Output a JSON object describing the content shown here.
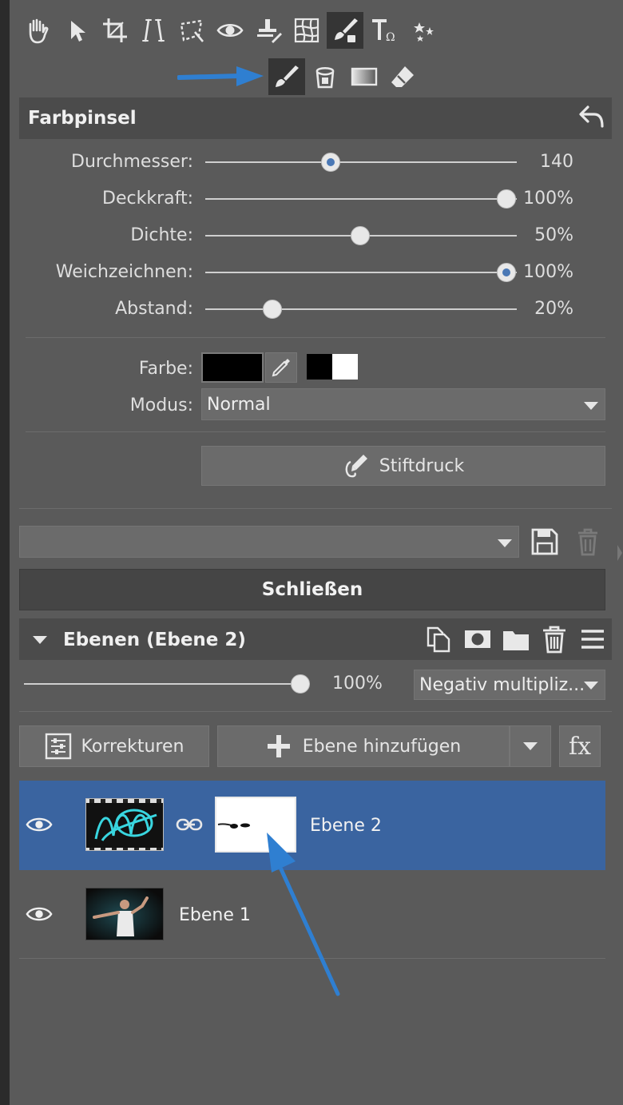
{
  "toolbar": {
    "tools": [
      "hand-icon",
      "pointer-icon",
      "crop-icon",
      "straighten-icon",
      "perspective-icon",
      "eye-icon",
      "stamp-icon",
      "grid-icon",
      "brush-icon",
      "text-icon",
      "effects-icon"
    ],
    "active_tool": "brush-icon",
    "subtools": [
      "paint-brush-icon",
      "bucket-icon",
      "gradient-icon",
      "eraser-icon"
    ],
    "active_subtool": "paint-brush-icon"
  },
  "brush_panel": {
    "title": "Farbpinsel",
    "sliders": [
      {
        "label": "Durchmesser:",
        "value_text": "140",
        "fraction": 0.4,
        "accent": true
      },
      {
        "label": "Deckkraft:",
        "value_text": "100%",
        "fraction": 1.0,
        "accent": false
      },
      {
        "label": "Dichte:",
        "value_text": "50%",
        "fraction": 0.5,
        "accent": false
      },
      {
        "label": "Weichzeichnen:",
        "value_text": "100%",
        "fraction": 1.0,
        "accent": true
      },
      {
        "label": "Abstand:",
        "value_text": "20%",
        "fraction": 0.2,
        "accent": false
      }
    ],
    "color_label": "Farbe:",
    "mode_label": "Modus:",
    "mode_value": "Normal",
    "pressure_button": "Stiftdruck"
  },
  "presets": {
    "close_label": "Schließen"
  },
  "layers": {
    "title": "Ebenen (Ebene 2)",
    "opacity_text": "100%",
    "opacity_fraction": 1.0,
    "blend_mode": "Negativ multipliz...",
    "corrections_label": "Korrekturen",
    "add_layer_label": "Ebene hinzufügen",
    "fx_label": "fx",
    "items": [
      {
        "name": "Ebene 2",
        "selected": true
      },
      {
        "name": "Ebene 1",
        "selected": false
      }
    ]
  },
  "colors": {
    "panel_bg": "#5a5a5a",
    "header_bg": "#4b4b4b",
    "selection_blue": "#3a64a0",
    "annotation_arrow": "#2f7fd1",
    "slider_accent": "#4a78b5"
  }
}
